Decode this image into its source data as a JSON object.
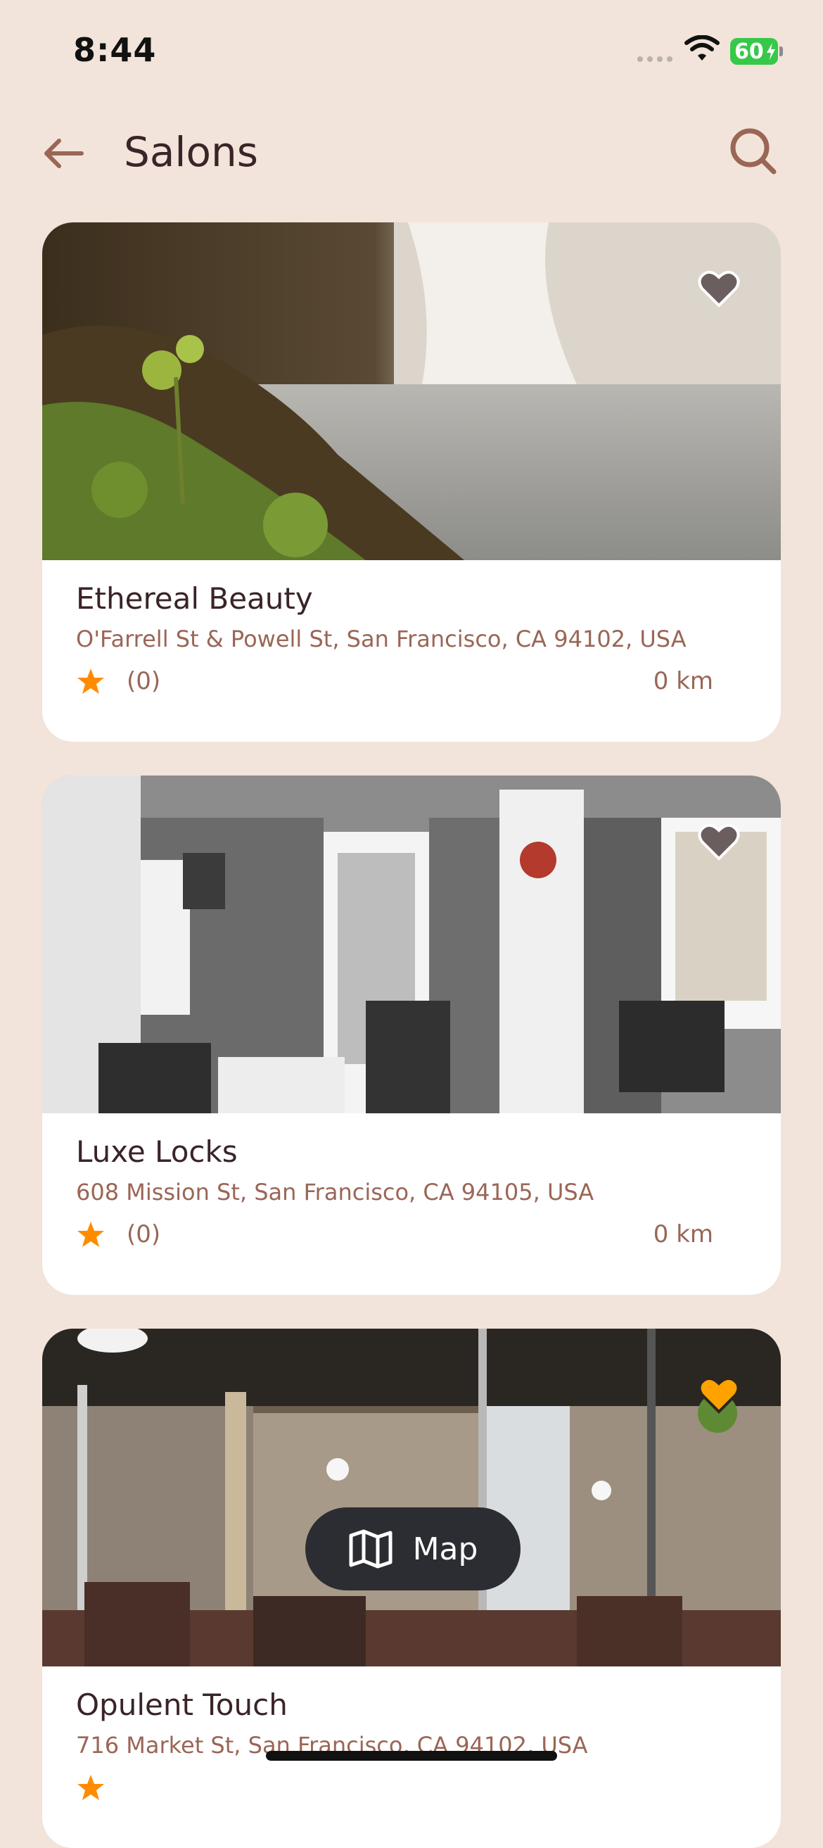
{
  "status_bar": {
    "time": "8:44",
    "battery": "60"
  },
  "header": {
    "title": "Salons"
  },
  "salons": [
    {
      "name": "Ethereal Beauty",
      "address": "O'Farrell St & Powell St, San Francisco, CA 94102, USA",
      "rating_count": "(0)",
      "distance": "0 km",
      "favorite": false
    },
    {
      "name": "Luxe Locks",
      "address": "608 Mission St, San Francisco, CA 94105, USA",
      "rating_count": "(0)",
      "distance": "0 km",
      "favorite": false
    },
    {
      "name": "Opulent Touch",
      "address": "716 Market St, San Francisco, CA 94102, USA",
      "rating_count": "",
      "distance": "",
      "favorite": true
    }
  ],
  "map_button": {
    "label": "Map"
  },
  "colors": {
    "background": "#F2E4DA",
    "accent": "#FF8C00",
    "text_primary": "#3A2428",
    "text_secondary": "#9A6656",
    "map_button_bg": "#2C2D32"
  },
  "icons": {
    "back": "arrow-left-icon",
    "search": "search-icon",
    "favorite": "heart-icon",
    "rating": "star-icon",
    "map": "map-icon"
  }
}
